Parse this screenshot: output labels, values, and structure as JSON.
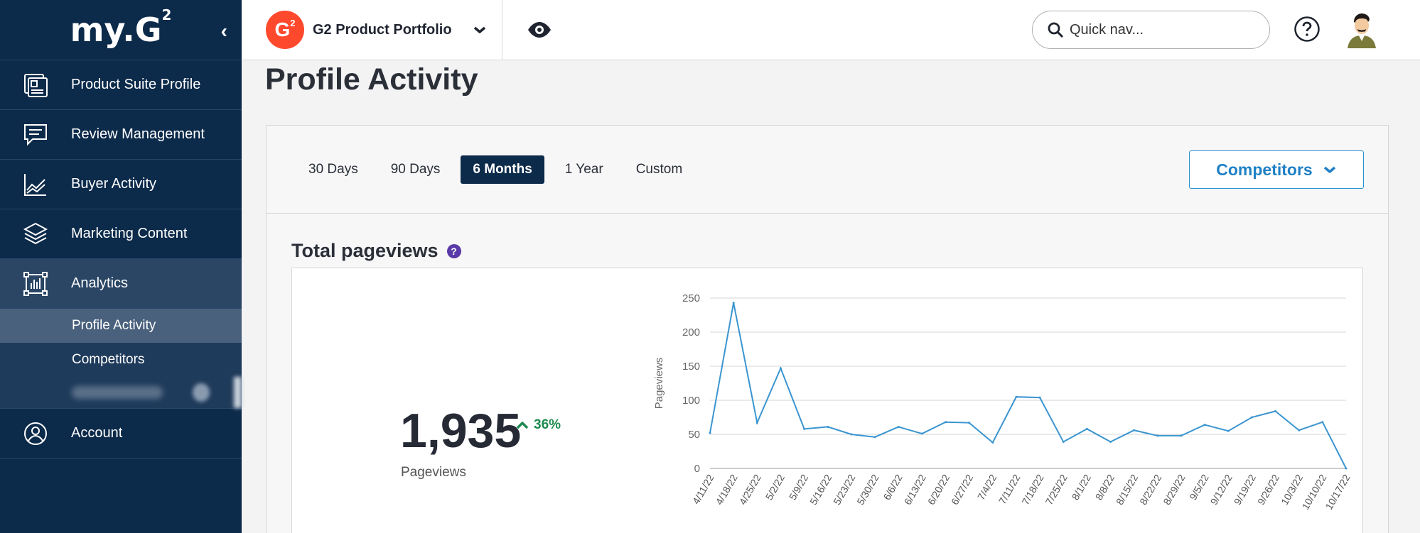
{
  "sidebar": {
    "logo": "my.G",
    "logo_sup": "2",
    "collapse_glyph": "‹",
    "items": [
      {
        "label": "Product Suite Profile",
        "icon": "profile-icon"
      },
      {
        "label": "Review Management",
        "icon": "review-chat-icon"
      },
      {
        "label": "Buyer Activity",
        "icon": "trend-chart-icon"
      },
      {
        "label": "Marketing Content",
        "icon": "layers-icon"
      },
      {
        "label": "Analytics",
        "icon": "analytics-icon"
      }
    ],
    "analytics_sub": [
      {
        "label": "Profile Activity"
      },
      {
        "label": "Competitors"
      }
    ],
    "account": {
      "label": "Account",
      "icon": "user-circle-icon"
    }
  },
  "topbar": {
    "badge": "G",
    "badge_sup": "2",
    "product_name": "G2 Product Portfolio",
    "search_placeholder": "Quick nav..."
  },
  "main": {
    "title": "Profile Activity",
    "range_tabs": [
      "30 Days",
      "90 Days",
      "6 Months",
      "1 Year",
      "Custom"
    ],
    "active_range": "6 Months",
    "competitors_label": "Competitors",
    "section_title": "Total pageviews",
    "section_help": "?",
    "kpi": {
      "value": "1,935",
      "change": "36%",
      "label": "Pageviews"
    }
  },
  "colors": {
    "sidebar": "#0c2a4a",
    "accent": "#2a8fd0",
    "line": "#3a95d0",
    "positive": "#1d8a4f",
    "brand": "#ff492c"
  },
  "chart_data": {
    "type": "line",
    "ylabel": "Pageviews",
    "xlabel": "",
    "ylim": [
      0,
      250
    ],
    "yticks": [
      0,
      50,
      100,
      150,
      200,
      250
    ],
    "grid": true,
    "categories": [
      "4/11/22",
      "4/18/22",
      "4/25/22",
      "5/2/22",
      "5/9/22",
      "5/16/22",
      "5/23/22",
      "5/30/22",
      "6/6/22",
      "6/13/22",
      "6/20/22",
      "6/27/22",
      "7/4/22",
      "7/11/22",
      "7/18/22",
      "7/25/22",
      "8/1/22",
      "8/8/22",
      "8/15/22",
      "8/22/22",
      "8/29/22",
      "9/5/22",
      "9/12/22",
      "9/19/22",
      "9/26/22",
      "10/3/22",
      "10/10/22",
      "10/17/22"
    ],
    "series": [
      {
        "values": [
          52,
          243,
          67,
          147,
          58,
          61,
          50,
          46,
          61,
          51,
          68,
          67,
          38,
          105,
          104,
          39,
          58,
          39,
          56,
          48,
          48,
          64,
          55,
          75,
          84,
          56,
          68,
          0
        ]
      }
    ]
  }
}
